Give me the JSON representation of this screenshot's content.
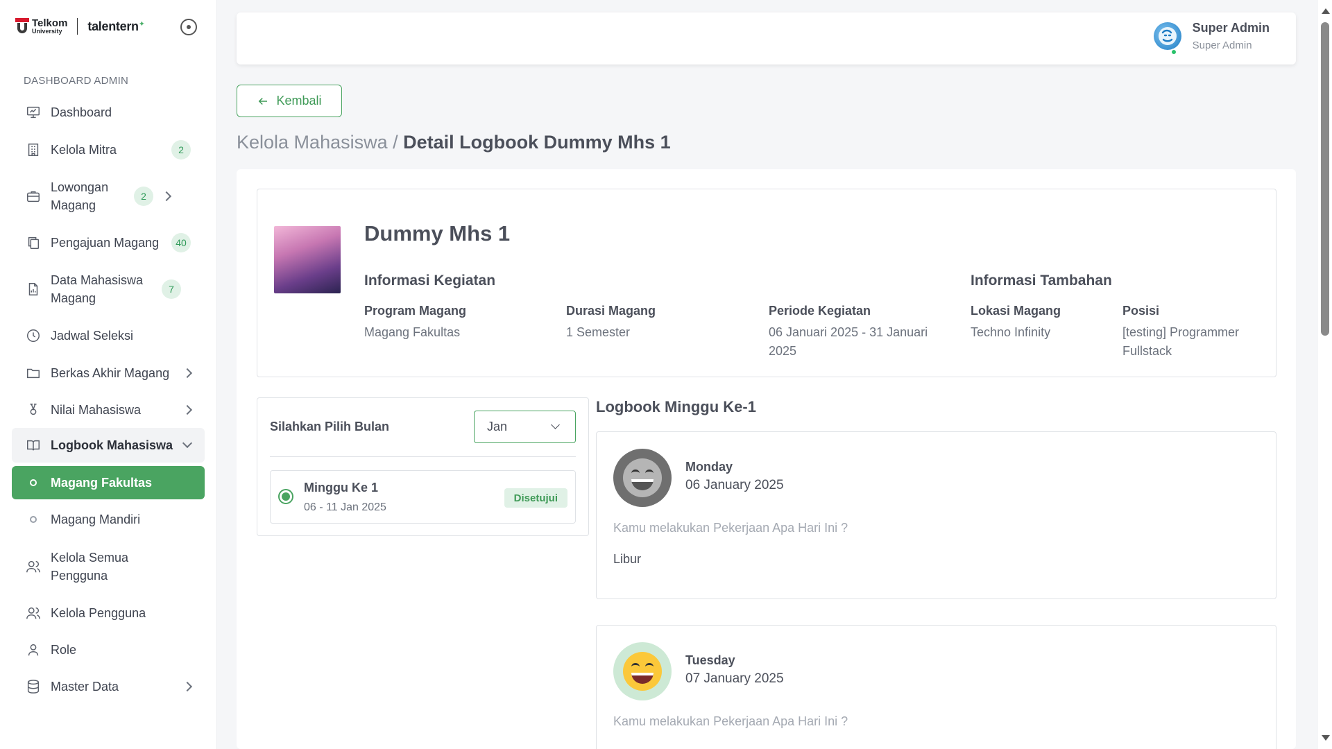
{
  "brand": {
    "telkom": "Telkom",
    "telkom_sub": "University",
    "talentern": "talentern"
  },
  "sidebar": {
    "section_label": "DASHBOARD ADMIN",
    "items": [
      {
        "label": "Dashboard",
        "icon": "monitor-icon"
      },
      {
        "label": "Kelola Mitra",
        "icon": "building-icon",
        "badge": "2"
      },
      {
        "label": "Lowongan Magang",
        "icon": "briefcase-icon",
        "badge": "2",
        "has_chevron": true
      },
      {
        "label": "Pengajuan Magang",
        "icon": "copy-icon",
        "badge": "40"
      },
      {
        "label": "Data Mahasiswa Magang",
        "icon": "file-chart-icon",
        "badge": "7"
      },
      {
        "label": "Jadwal Seleksi",
        "icon": "clock-icon"
      },
      {
        "label": "Berkas Akhir Magang",
        "icon": "folder-icon",
        "has_chevron": true
      },
      {
        "label": "Nilai Mahasiswa",
        "icon": "award-icon",
        "has_chevron": true
      },
      {
        "label": "Logbook Mahasiswa",
        "icon": "book-open-icon",
        "expanded": true
      },
      {
        "label": "Magang Fakultas",
        "sub": true,
        "active": true
      },
      {
        "label": "Magang Mandiri",
        "sub": true
      },
      {
        "label": "Kelola Semua Pengguna",
        "icon": "users-icon"
      },
      {
        "label": "Kelola Pengguna",
        "icon": "users-icon"
      },
      {
        "label": "Role",
        "icon": "user-icon"
      },
      {
        "label": "Master Data",
        "icon": "database-icon",
        "has_chevron": true
      }
    ]
  },
  "topbar": {
    "user_name": "Super Admin",
    "user_role": "Super Admin"
  },
  "back_button": "Kembali",
  "breadcrumb": {
    "parent": "Kelola Mahasiswa /",
    "current": "Detail Logbook Dummy Mhs 1"
  },
  "profile": {
    "name": "Dummy Mhs 1",
    "info_kegiatan_title": "Informasi Kegiatan",
    "info_tambahan_title": "Informasi Tambahan",
    "program_label": "Program Magang",
    "program_value": "Magang Fakultas",
    "durasi_label": "Durasi Magang",
    "durasi_value": "1 Semester",
    "periode_label": "Periode Kegiatan",
    "periode_value": "06 Januari 2025 - 31 Januari 2025",
    "lokasi_label": "Lokasi Magang",
    "lokasi_value": "Techno Infinity",
    "posisi_label": "Posisi",
    "posisi_value": "[testing] Programmer Fullstack"
  },
  "month_picker": {
    "label": "Silahkan Pilih Bulan",
    "selected": "Jan",
    "weeks": [
      {
        "title": "Minggu Ke 1",
        "range": "06  -  11 Jan 2025",
        "status": "Disetujui"
      }
    ]
  },
  "logbook": {
    "title": "Logbook Minggu Ke-1",
    "question": "Kamu melakukan Pekerjaan Apa Hari Ini ?",
    "days": [
      {
        "day": "Monday",
        "date": "06 January 2025",
        "answer": "Libur",
        "mood": "grayscale-grin-emoji"
      },
      {
        "day": "Tuesday",
        "date": "07 January 2025",
        "answer": "",
        "mood": "grin-emoji"
      }
    ]
  },
  "colors": {
    "accent": "#4aa461",
    "badge_bg": "#e0f1e6"
  }
}
